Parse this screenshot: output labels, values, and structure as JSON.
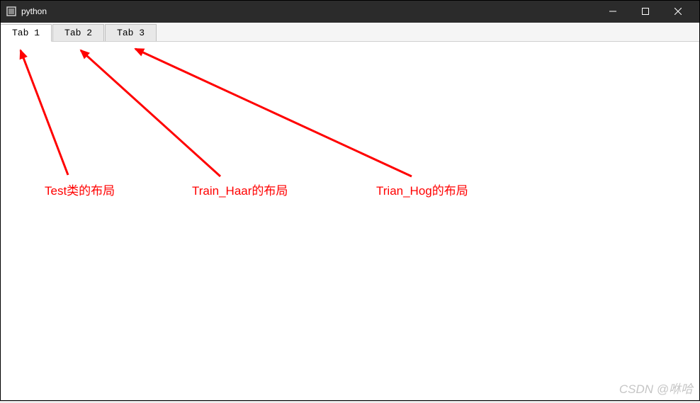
{
  "window": {
    "title": "python"
  },
  "tabs": {
    "0": {
      "label": "Tab 1"
    },
    "1": {
      "label": "Tab 2"
    },
    "2": {
      "label": "Tab 3"
    }
  },
  "annotations": {
    "0": {
      "text": "Test类的布局"
    },
    "1": {
      "text": "Train_Haar的布局"
    },
    "2": {
      "text": "Trian_Hog的布局"
    }
  },
  "watermark": "CSDN @咻哈"
}
